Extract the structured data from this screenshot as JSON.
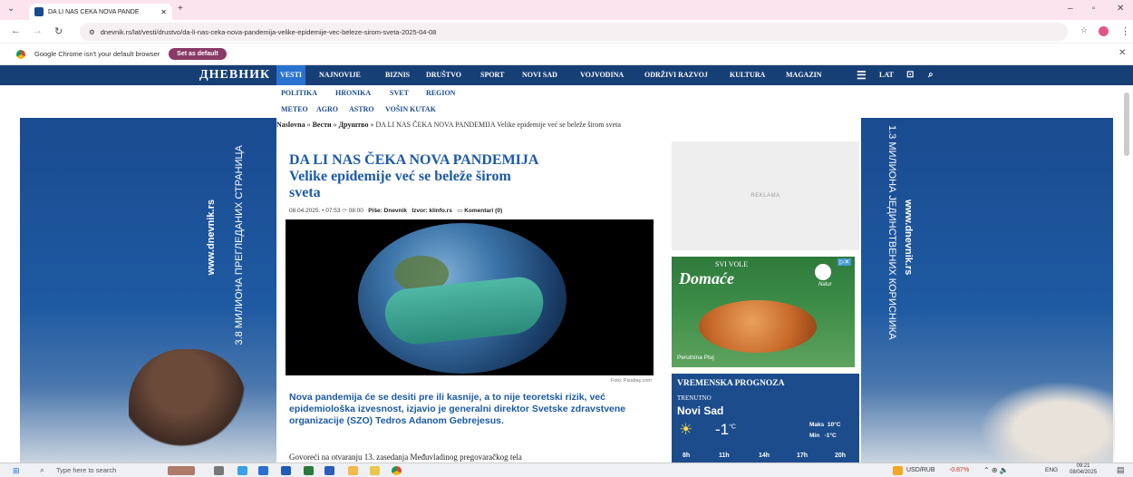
{
  "browser": {
    "tab_title": "DA LI NAS ČEKA NOVA PANDE",
    "url": "dnevnik.rs/lat/vesti/drustvo/da-li-nas-ceka-nova-pandemija-velike-epidemije-vec-beleze-sirom-sveta-2025-04-08",
    "infobar_text": "Google Chrome isn't your default browser",
    "set_default_label": "Set as default"
  },
  "site": {
    "logo": "ДНЕВНИК",
    "nav": [
      "VESTI",
      "NAJNOVIJE",
      "BIZNIS",
      "DRUŠTVO",
      "SPORT",
      "NOVI SAD",
      "VOJVODINA",
      "ODRŽIVI RAZVOJ",
      "KULTURA",
      "MAGAZIN"
    ],
    "lang": "LAT",
    "subnav1": [
      "POLITIKA",
      "HRONIKA",
      "SVET",
      "REGION"
    ],
    "subnav2": [
      "METEO",
      "AGRO",
      "ASTRO",
      "VOŠIN KUTAK"
    ],
    "breadcrumb": {
      "home": "Naslovna",
      "sep": "»",
      "section": "Вести",
      "subsection": "Друштво",
      "current": "DA LI NAS ČEKA NOVA PANDEMIJA Velike epidemije već se beleže širom sveta"
    },
    "left_banner": {
      "line1": "www.dnevnik.rs",
      "line2": "3.8 МИЛИОНА ПРЕГЛЕДАНИХ СТРАНИЦА"
    },
    "right_banner": {
      "line1": "1.3 МИЛИОНА ЈЕДИНСТВЕНИХ КОРИСНИКА",
      "line2": "www.dnevnik.rs"
    }
  },
  "article": {
    "title_line1": "DA LI NAS ČEKA NOVA PANDEMIJA",
    "title_line2": "Velike epidemije već se beleže širom",
    "title_line3": "sveta",
    "date": "08.04.2025.",
    "time": "07:53",
    "updated": "08:00",
    "author_label": "Piše:",
    "author": "Dnevnik",
    "source_label": "Izvor:",
    "source": "klinfo.rs",
    "comments": "Komentari (0)",
    "photo_credit": "Foto: Pixabay.com",
    "lead": "Nova pandemija će se desiti pre ili kasnije, a to nije teoretski rizik, već epidemiološka izvesnost, izjavio je generalni direktor Svetske zdravstvene organizacije (SZO) Tedros Adanom Gebrejesus.",
    "body": "Govoreći na otvaranju 13. zasedanja Međuvladinog pregovaračkog tela"
  },
  "sidebar": {
    "ad_label": "REKLAMA",
    "ad_top": "SVI VOLE",
    "ad_brand": "Domaće",
    "ad_brand2": "Natur",
    "ad_caption": "Perutnina Ptuj",
    "weather": {
      "title": "VREMENSKA PROGNOZA",
      "now_label": "TRENUTNO",
      "city": "Novi Sad",
      "temp": "-1",
      "unit": "°C",
      "max_label": "Maks",
      "max": "10°C",
      "min_label": "Min",
      "min": "-1°C",
      "hours": [
        "8h",
        "11h",
        "14h",
        "17h",
        "20h"
      ]
    }
  },
  "taskbar": {
    "search_placeholder": "Type here to search",
    "ticker": "USD/RUB",
    "change": "-0.87%",
    "lang": "ENG",
    "time": "09:21",
    "date": "08/04/2025"
  }
}
